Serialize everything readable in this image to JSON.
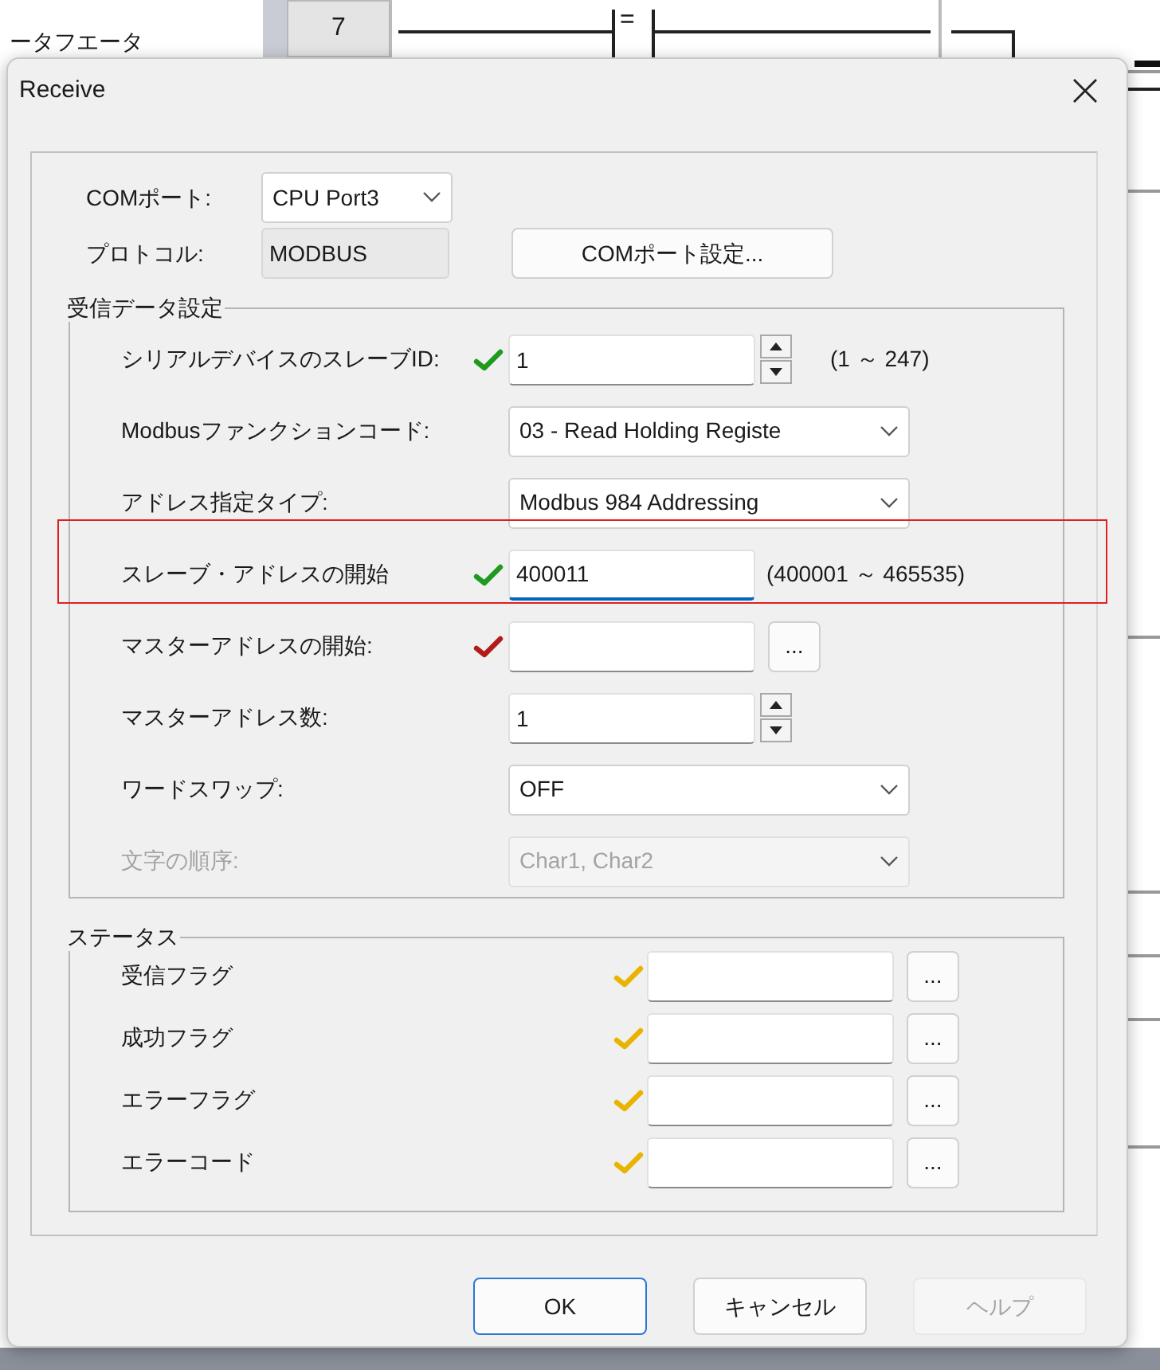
{
  "background": {
    "row_number": "7",
    "contact_label": "=",
    "side_text": "ータフエータ"
  },
  "dialog": {
    "title": "Receive",
    "com_port": {
      "label": "COMポート:",
      "value": "CPU Port3"
    },
    "protocol": {
      "label": "プロトコル:",
      "value": "MODBUS"
    },
    "com_settings_button": "COMポート設定...",
    "receive_group": {
      "title": "受信データ設定",
      "rows": [
        {
          "kind": "spin",
          "label": "シリアルデバイスのスレーブID:",
          "color": "#1f9a1f",
          "value": "1",
          "range": "(1 ～ 247)",
          "disabled": false
        },
        {
          "kind": "select",
          "label": "Modbusファンクションコード:",
          "value": "03 - Read Holding Registe",
          "disabled": false
        },
        {
          "kind": "select",
          "label": "アドレス指定タイプ:",
          "value": "Modbus 984 Addressing",
          "disabled": false
        },
        {
          "kind": "text",
          "label": "スレーブ・アドレスの開始",
          "color": "#1f9a1f",
          "value": "400011",
          "range": "(400001 ～ 465535)",
          "disabled": false,
          "focused": true,
          "highlighted": true
        },
        {
          "kind": "browse",
          "label": "マスターアドレスの開始:",
          "color": "#b31b1b",
          "value": "",
          "button": "...",
          "disabled": false
        },
        {
          "kind": "spin",
          "label": "マスターアドレス数:",
          "value": "1",
          "disabled": false
        },
        {
          "kind": "select",
          "label": "ワードスワップ:",
          "value": "OFF",
          "disabled": false
        },
        {
          "kind": "select",
          "label": "文字の順序:",
          "value": "Char1, Char2",
          "disabled": true
        }
      ]
    },
    "status_group": {
      "title": "ステータス",
      "rows": [
        {
          "label": "受信フラグ",
          "color": "#e8b400",
          "button": "..."
        },
        {
          "label": "成功フラグ",
          "color": "#e8b400",
          "button": "..."
        },
        {
          "label": "エラーフラグ",
          "color": "#e8b400",
          "button": "..."
        },
        {
          "label": "エラーコード",
          "color": "#e8b400",
          "button": "..."
        }
      ]
    },
    "buttons": [
      {
        "label": "OK",
        "default": true,
        "disabled": false
      },
      {
        "label": "キャンセル",
        "default": false,
        "disabled": false
      },
      {
        "label": "ヘルプ",
        "default": false,
        "disabled": true
      }
    ]
  }
}
